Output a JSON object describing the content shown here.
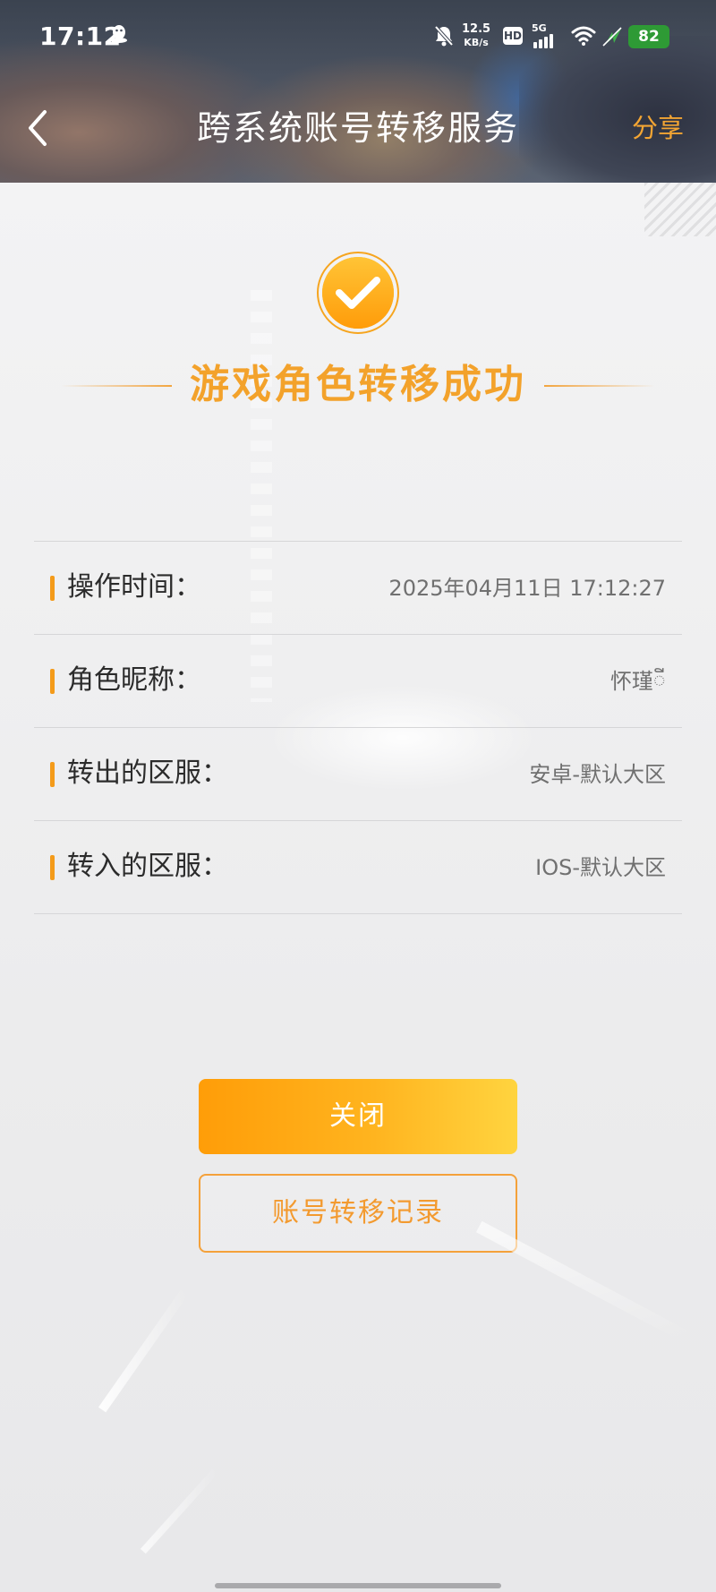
{
  "status_bar": {
    "time": "17:12",
    "net_speed_value": "12.5",
    "net_speed_unit": "KB/s",
    "hd_badge": "HD",
    "network_type": "5G",
    "battery": "82",
    "icons": [
      "qq-notification-icon",
      "mute-bell-icon",
      "hd-icon",
      "signal-icon",
      "wifi-icon",
      "charging-icon",
      "battery-icon"
    ]
  },
  "nav": {
    "title": "跨系统账号转移服务",
    "share_label": "分享",
    "back_icon": "chevron-left-icon"
  },
  "success": {
    "icon": "check-circle-icon",
    "title": "游戏角色转移成功"
  },
  "info": {
    "rows": [
      {
        "label": "操作时间：",
        "value": "2025年04月11日 17:12:27"
      },
      {
        "label": "角色昵称：",
        "value": "怀瑾ី"
      },
      {
        "label": "转出的区服：",
        "value": "安卓-默认大区"
      },
      {
        "label": "转入的区服：",
        "value": "IOS-默认大区"
      }
    ]
  },
  "actions": {
    "close_label": "关闭",
    "history_label": "账号转移记录"
  },
  "colors": {
    "accent": "#F49B1A",
    "accent_text": "#F3A22B",
    "battery": "#2E9A35",
    "background": "#F0F0F1"
  }
}
